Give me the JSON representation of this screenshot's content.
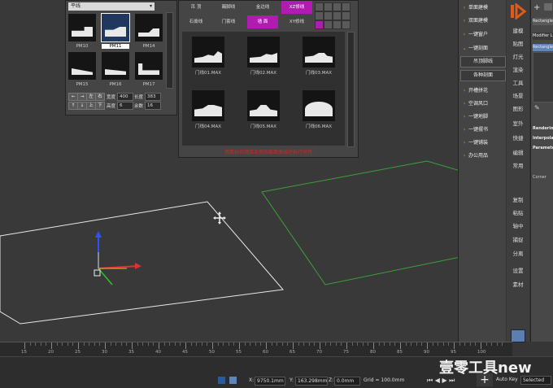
{
  "profile_library": {
    "category_dropdown": "平线",
    "thumbs": [
      "PM10",
      "PM11",
      "PM14",
      "PM15",
      "PM16",
      "PM17"
    ],
    "controls": {
      "left_label": "左",
      "right_label": "右",
      "up_label": "上",
      "down_label": "下",
      "width_label": "宽度",
      "width_value": "400",
      "height_label": "高度",
      "height_value": "6",
      "length_label": "长度",
      "length_value": "383",
      "offset_label": "余数",
      "offset_value": "16"
    }
  },
  "profile_browser": {
    "tabs_row1": [
      "吊  顶",
      "踢脚线",
      "金边线",
      "XZ修线"
    ],
    "tabs_row2": [
      "石膏线",
      "门套线",
      "墙  面",
      "XY修线"
    ],
    "items": [
      "门线01.MAX",
      "门线02.MAX",
      "门线03.MAX",
      "门线04.MAX",
      "门线05.MAX",
      "门线06.MAX"
    ],
    "hint": "用鼠标右键双击拖放截面曲线时执行对齐"
  },
  "plugin_menu": {
    "items": [
      "单面建模",
      "双面建模",
      "一键窗户",
      "一键剖面",
      "吊顶脚线",
      "各种剖面",
      "开槽拼花",
      "空调风口",
      "一键地脚",
      "一键摆书",
      "一键铺装",
      "办公用品"
    ]
  },
  "logo_strip": {
    "labels": [
      "建模",
      "贴图",
      "灯光",
      "渲染",
      "工具",
      "场景",
      "图形",
      "室外",
      "快捷",
      "编辑",
      "常用",
      "复制",
      "粘贴",
      "轴中",
      "捕捉",
      "分离",
      "设置",
      "素材"
    ]
  },
  "command_panel": {
    "fields": [
      "Rectangle",
      "Modifier List",
      "Rectangle",
      "Rendering",
      "Interpolation",
      "Parameters"
    ],
    "corner": "Corner"
  },
  "timeline": {
    "ticks": [
      "15",
      "20",
      "25",
      "30",
      "35",
      "40",
      "45",
      "50",
      "55",
      "60",
      "65",
      "70",
      "75",
      "80",
      "85",
      "90",
      "95",
      "100"
    ]
  },
  "status": {
    "x_label": "X:",
    "x_value": "9750.1mm",
    "y_label": "Y:",
    "y_value": "163.298mm",
    "z_label": "Z:",
    "z_value": "0.0mm",
    "grid": "Grid = 100.0mm",
    "auto_key": "Auto Key",
    "selected": "Selected",
    "set_key": "Set Key",
    "key_filters": "Key Filters..."
  },
  "watermark": "壹零工具new"
}
